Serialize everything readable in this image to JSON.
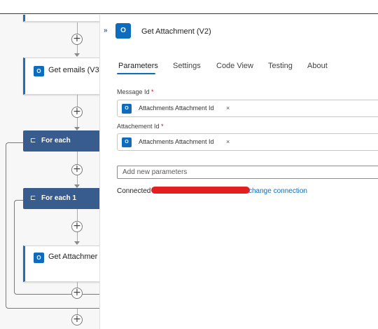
{
  "canvas": {
    "cards": {
      "get_emails": {
        "title": "Get emails (V3",
        "icon": "outlook-icon",
        "icon_glyph": "O"
      },
      "get_attachment": {
        "title": "Get Attachmer",
        "icon": "outlook-icon",
        "icon_glyph": "O"
      }
    },
    "loops": {
      "for_each": {
        "label": "For each",
        "icon_glyph": "⊏"
      },
      "for_each_1": {
        "label": "For each 1",
        "icon_glyph": "⊏"
      }
    },
    "plus_glyph": "+"
  },
  "panel": {
    "collapse_glyph": "»",
    "icon_glyph": "O",
    "title": "Get Attachment (V2)",
    "tabs": [
      {
        "label": "Parameters",
        "active": true
      },
      {
        "label": "Settings",
        "active": false
      },
      {
        "label": "Code View",
        "active": false
      },
      {
        "label": "Testing",
        "active": false
      },
      {
        "label": "About",
        "active": false
      }
    ],
    "fields": [
      {
        "label": "Message Id",
        "required_mark": "*",
        "token": "Attachments Attachment Id",
        "remove_glyph": "×"
      },
      {
        "label": "Attachement Id",
        "required_mark": "*",
        "token": "Attachments Attachment Id",
        "remove_glyph": "×"
      }
    ],
    "add_parameters_placeholder": "Add new parameters",
    "connected_label": "Connected",
    "change_connection_label": "change connection"
  },
  "colors": {
    "accent": "#0f6cbd",
    "loop_header": "#385c8e",
    "redaction": "#e41f1f"
  }
}
